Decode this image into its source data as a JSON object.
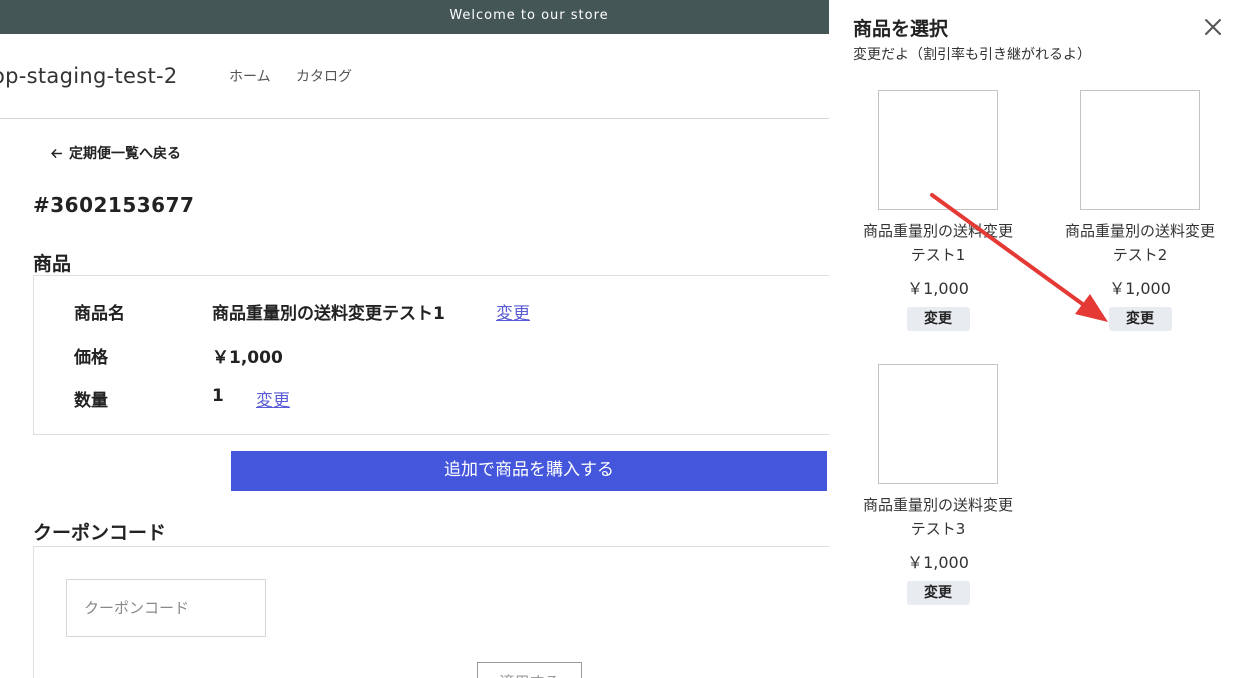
{
  "announcement": "Welcome to our store",
  "header": {
    "store_name": "op-staging-test-2",
    "nav": [
      {
        "label": "ホーム"
      },
      {
        "label": "カタログ"
      }
    ]
  },
  "back_link": "定期便一覧へ戻る",
  "order_number": "#3602153677",
  "product_section": {
    "title": "商品",
    "rows": {
      "name_label": "商品名",
      "name_value": "商品重量別の送料変更テスト1",
      "name_change": "変更",
      "price_label": "価格",
      "price_value": "￥1,000",
      "qty_label": "数量",
      "qty_value": "1",
      "qty_change": "変更"
    },
    "buy_more_label": "追加で商品を購入する"
  },
  "coupon_section": {
    "title": "クーポンコード",
    "input_placeholder": "クーポンコード",
    "apply_label": "適用する"
  },
  "drawer": {
    "title": "商品を選択",
    "subtitle": "変更だよ（割引率も引き継がれるよ）",
    "products": [
      {
        "name_line1": "商品重量別の送料変更",
        "name_line2": "テスト1",
        "price": "￥1,000",
        "button": "変更"
      },
      {
        "name_line1": "商品重量別の送料変更",
        "name_line2": "テスト2",
        "price": "￥1,000",
        "button": "変更"
      },
      {
        "name_line1": "商品重量別の送料変更",
        "name_line2": "テスト3",
        "price": "￥1,000",
        "button": "変更"
      }
    ]
  },
  "colors": {
    "announcement_bg": "#445756",
    "primary_button": "#4356dc",
    "link": "#5a5bd6",
    "annotation_arrow": "#e53935",
    "choice_button_bg": "#e8ecf1"
  }
}
